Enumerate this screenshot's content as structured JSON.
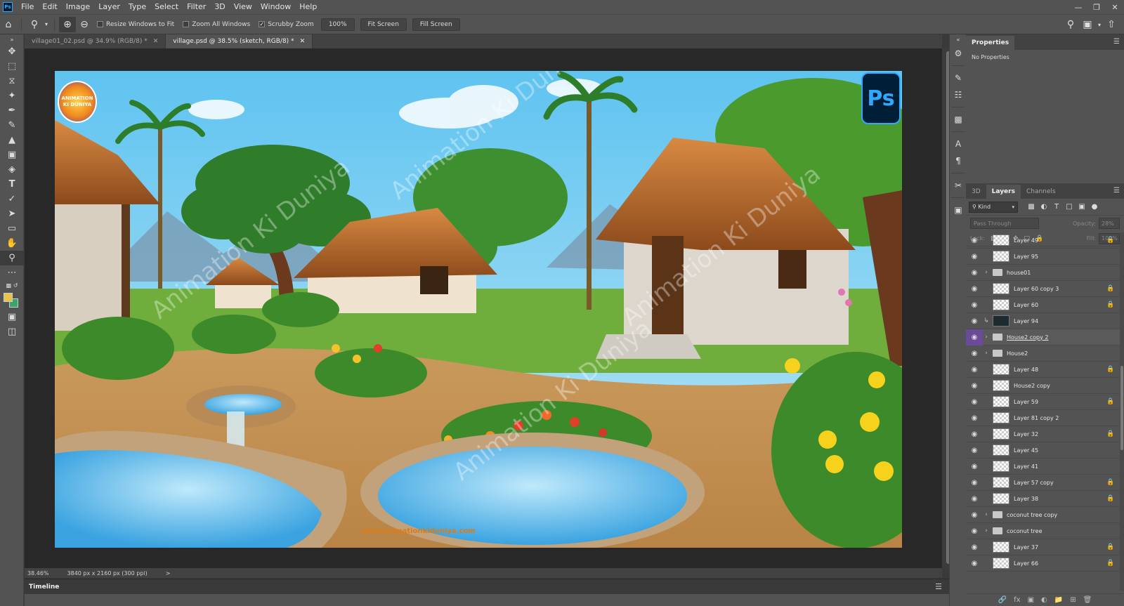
{
  "menubar": {
    "items": [
      "File",
      "Edit",
      "Image",
      "Layer",
      "Type",
      "Select",
      "Filter",
      "3D",
      "View",
      "Window",
      "Help"
    ]
  },
  "options": {
    "resize_windows": "Resize Windows to Fit",
    "zoom_all": "Zoom All Windows",
    "scrubby_zoom": "Scrubby Zoom",
    "zoom_value": "100%",
    "fit_screen": "Fit Screen",
    "fill_screen": "Fill Screen"
  },
  "tabs": [
    {
      "label": "village01_02.psd @ 34.9% (RGB/8) *"
    },
    {
      "label": "village.psd @ 38.5% (sketch, RGB/8) *"
    }
  ],
  "artwork": {
    "watermark": "Animation Ki Duniya",
    "logo_text": "ANIMATION KI DUNIYA",
    "ps_badge": "Ps",
    "site_url": "www.animationkiduniya.com"
  },
  "status": {
    "zoom": "38.46%",
    "doc_size": "3840 px x 2160 px (300 ppi)",
    "arrow": ">"
  },
  "timeline": {
    "label": "Timeline"
  },
  "properties": {
    "tab": "Properties",
    "body": "No Properties"
  },
  "layers_panel": {
    "tabs": [
      "3D",
      "Layers",
      "Channels"
    ],
    "kind": "Kind",
    "blend": "Pass Through",
    "opacity_label": "Opacity:",
    "opacity_value": "28%",
    "lock_label": "Lock:",
    "fill_label": "Fill:",
    "fill_value": "100%",
    "layers": [
      {
        "name": "Layer 49",
        "kind": "layer",
        "lock": true
      },
      {
        "name": "Layer 95",
        "kind": "layer",
        "lock": false
      },
      {
        "name": "house01",
        "kind": "group",
        "lock": false
      },
      {
        "name": "Layer 60 copy 3",
        "kind": "layer",
        "lock": true
      },
      {
        "name": "Layer 60",
        "kind": "layer",
        "lock": true
      },
      {
        "name": "Layer 94",
        "kind": "clip",
        "lock": false
      },
      {
        "name": "House2 copy 2",
        "kind": "group",
        "lock": false,
        "selected": true
      },
      {
        "name": "House2",
        "kind": "group",
        "lock": false
      },
      {
        "name": "Layer 48",
        "kind": "layer",
        "lock": true
      },
      {
        "name": "House2 copy",
        "kind": "layer",
        "lock": false
      },
      {
        "name": "Layer 59",
        "kind": "layer",
        "lock": true
      },
      {
        "name": "Layer 81 copy 2",
        "kind": "layer",
        "lock": false
      },
      {
        "name": "Layer 32",
        "kind": "layer",
        "lock": true
      },
      {
        "name": "Layer 45",
        "kind": "layer",
        "lock": false
      },
      {
        "name": "Layer 41",
        "kind": "layer",
        "lock": false
      },
      {
        "name": "Layer 57 copy",
        "kind": "layer",
        "lock": true
      },
      {
        "name": "Layer 38",
        "kind": "layer",
        "lock": true
      },
      {
        "name": "coconut tree copy",
        "kind": "group",
        "lock": false
      },
      {
        "name": "coconut tree",
        "kind": "group",
        "lock": false
      },
      {
        "name": "Layer 37",
        "kind": "layer",
        "lock": true
      },
      {
        "name": "Layer 66",
        "kind": "layer",
        "lock": true
      }
    ]
  }
}
